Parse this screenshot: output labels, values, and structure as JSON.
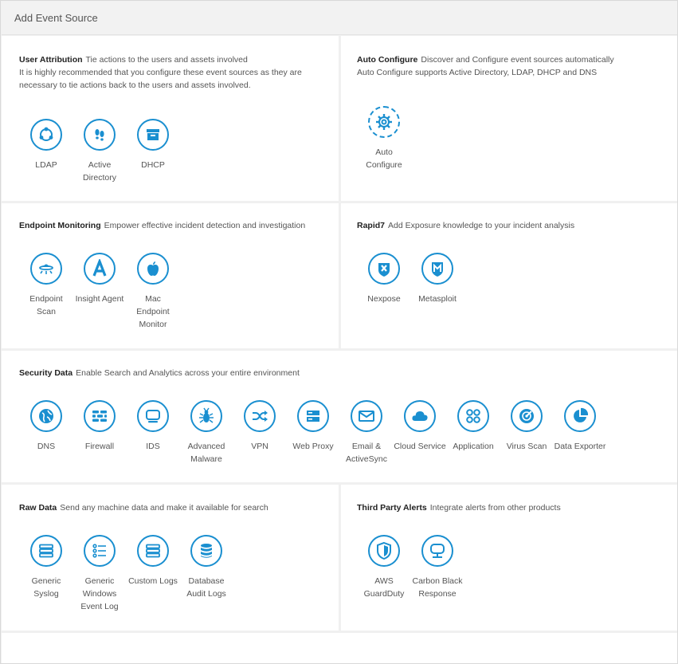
{
  "header": {
    "title": "Add Event Source"
  },
  "accent": "#1a8fd0",
  "sections": {
    "user_attribution": {
      "title": "User Attribution",
      "desc": "Tie actions to the users and assets involved",
      "desc2": "It is highly recommended that you configure these event sources as they are necessary to tie actions back to the users and assets involved.",
      "items": [
        {
          "label": "LDAP",
          "icon": "ldap-icon"
        },
        {
          "label": "Active Directory",
          "icon": "footprints-icon"
        },
        {
          "label": "DHCP",
          "icon": "box-icon"
        }
      ]
    },
    "auto_configure": {
      "title": "Auto Configure",
      "desc": "Discover and Configure event sources automatically",
      "desc2": "Auto Configure supports Active Directory, LDAP, DHCP and DNS",
      "items": [
        {
          "label": "Auto Configure",
          "icon": "gear-icon"
        }
      ]
    },
    "endpoint_monitoring": {
      "title": "Endpoint Monitoring",
      "desc": "Empower effective incident detection and investigation",
      "items": [
        {
          "label": "Endpoint Scan",
          "icon": "ufo-icon"
        },
        {
          "label": "Insight Agent",
          "icon": "letter-a-icon"
        },
        {
          "label": "Mac Endpoint Monitor",
          "icon": "apple-icon"
        }
      ]
    },
    "rapid7": {
      "title": "Rapid7",
      "desc": "Add Exposure knowledge to your incident analysis",
      "items": [
        {
          "label": "Nexpose",
          "icon": "nexpose-icon"
        },
        {
          "label": "Metasploit",
          "icon": "metasploit-icon"
        }
      ]
    },
    "security_data": {
      "title": "Security Data",
      "desc": "Enable Search and Analytics across your entire environment",
      "items": [
        {
          "label": "DNS",
          "icon": "globe-icon"
        },
        {
          "label": "Firewall",
          "icon": "brick-wall-icon"
        },
        {
          "label": "IDS",
          "icon": "monitor-icon"
        },
        {
          "label": "Advanced Malware",
          "icon": "bug-icon"
        },
        {
          "label": "VPN",
          "icon": "shuffle-icon"
        },
        {
          "label": "Web Proxy",
          "icon": "server-icon"
        },
        {
          "label": "Email & ActiveSync",
          "icon": "envelope-icon"
        },
        {
          "label": "Cloud Service",
          "icon": "cloud-icon"
        },
        {
          "label": "Application",
          "icon": "apps-icon"
        },
        {
          "label": "Virus Scan",
          "icon": "radar-icon"
        },
        {
          "label": "Data Exporter",
          "icon": "pie-chart-icon"
        }
      ]
    },
    "raw_data": {
      "title": "Raw Data",
      "desc": "Send any machine data and make it available for search",
      "items": [
        {
          "label": "Generic Syslog",
          "icon": "stack-icon"
        },
        {
          "label": "Generic Windows Event Log",
          "icon": "list-icon"
        },
        {
          "label": "Custom Logs",
          "icon": "stack-icon"
        },
        {
          "label": "Database Audit Logs",
          "icon": "database-icon"
        }
      ]
    },
    "third_party": {
      "title": "Third Party Alerts",
      "desc": "Integrate alerts from other products",
      "items": [
        {
          "label": "AWS GuardDuty",
          "icon": "shield-icon"
        },
        {
          "label": "Carbon Black Response",
          "icon": "display-icon"
        }
      ]
    }
  }
}
